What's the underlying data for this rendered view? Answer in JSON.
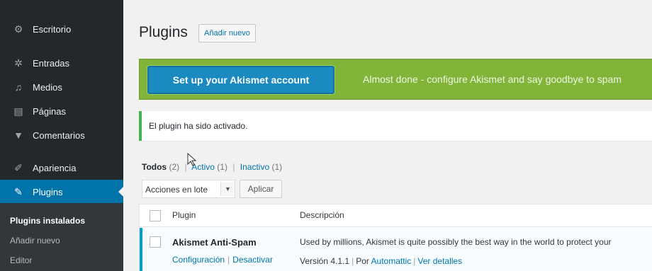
{
  "sidebar": {
    "items": [
      {
        "label": "Escritorio",
        "icon": "dashboard-icon",
        "glyph": "⚙"
      },
      {
        "label": "Entradas",
        "icon": "pin-icon",
        "glyph": "✲"
      },
      {
        "label": "Medios",
        "icon": "media-icon",
        "glyph": "♫"
      },
      {
        "label": "Páginas",
        "icon": "pages-icon",
        "glyph": "▤"
      },
      {
        "label": "Comentarios",
        "icon": "comments-icon",
        "glyph": "▼"
      },
      {
        "label": "Apariencia",
        "icon": "appearance-icon",
        "glyph": "✐"
      },
      {
        "label": "Plugins",
        "icon": "plugins-icon",
        "glyph": "✎"
      }
    ],
    "submenu": [
      "Plugins instalados",
      "Añadir nuevo",
      "Editor"
    ]
  },
  "header": {
    "title": "Plugins",
    "add_new": "Añadir nuevo"
  },
  "akismet": {
    "button": "Set up your Akismet account",
    "message": "Almost done - configure Akismet and say goodbye to spam"
  },
  "notice": "El plugin ha sido activado.",
  "filters": {
    "all_label": "Todos",
    "all_count": "(2)",
    "active_label": "Activo",
    "active_count": "(1)",
    "inactive_label": "Inactivo",
    "inactive_count": "(1)"
  },
  "bulk": {
    "select_value": "Acciones en lote",
    "apply": "Aplicar"
  },
  "table": {
    "col_plugin": "Plugin",
    "col_desc": "Descripción",
    "rows": [
      {
        "name": "Akismet Anti-Spam",
        "action_config": "Configuración",
        "action_deactivate": "Desactivar",
        "description": "Used by millions, Akismet is quite possibly the best way in the world to protect your",
        "version": "Versión 4.1.1",
        "by": "Por",
        "author": "Automattic",
        "details": "Ver detalles"
      }
    ]
  },
  "colors": {
    "sidebar_bg": "#23282d",
    "active_menu": "#0073aa",
    "akismet_green": "#81b53a",
    "akismet_button": "#1a8ac0",
    "notice_border": "#46b450",
    "link": "#0073aa"
  }
}
